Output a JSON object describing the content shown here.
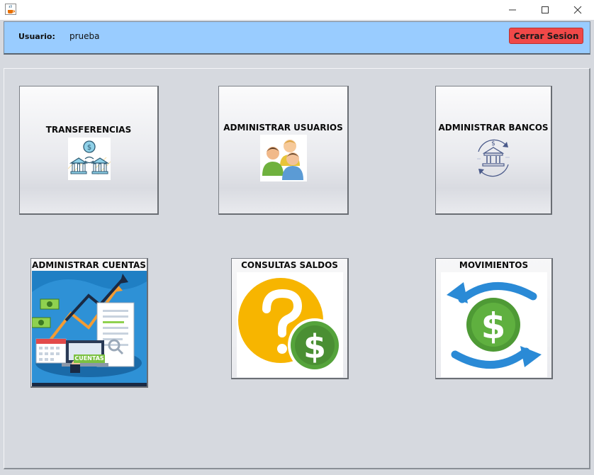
{
  "window": {
    "icons": {
      "app": "java-cup-icon",
      "minimize": "minimize-icon",
      "maximize": "maximize-icon",
      "close": "close-icon"
    }
  },
  "header": {
    "user_label": "Usuario:",
    "user_value": "prueba",
    "logout_label": "Cerrar Sesion",
    "logout_color": "#f04848",
    "bg_color": "#99ccff"
  },
  "tiles": [
    {
      "label": "TRANSFERENCIAS",
      "icon": "bank-transfer-icon"
    },
    {
      "label": "ADMINISTRAR USUARIOS",
      "icon": "users-group-icon"
    },
    {
      "label": "ADMINISTRAR BANCOS",
      "icon": "bank-cycle-icon"
    },
    {
      "label": "ADMINISTRAR CUENTAS",
      "icon": "accounts-illustration",
      "badge": "CUENTAS"
    },
    {
      "label": "CONSULTAS SALDOS",
      "icon": "question-dollar-icon"
    },
    {
      "label": "MOVIMIENTOS",
      "icon": "dollar-exchange-icon"
    }
  ]
}
